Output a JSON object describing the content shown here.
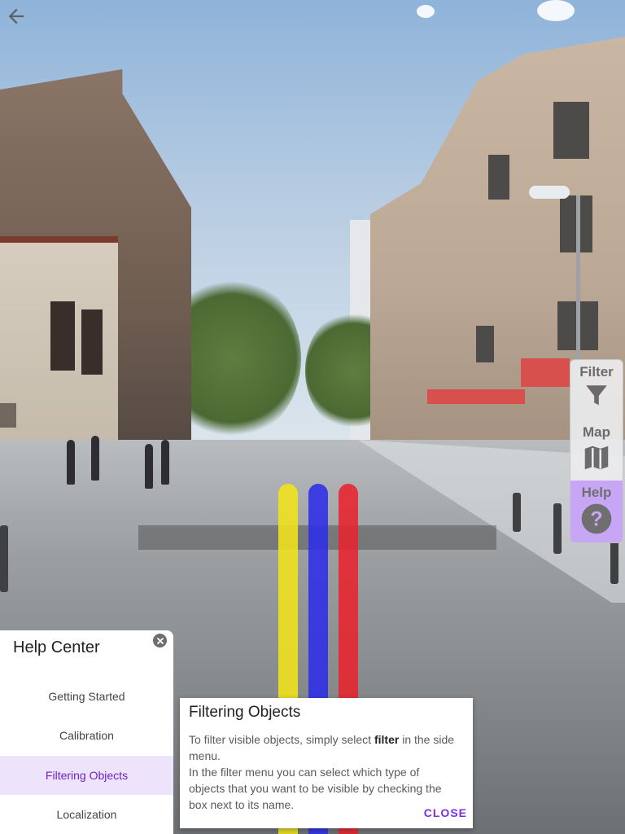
{
  "colors": {
    "accent": "#7b2fe0",
    "selected_bg": "#ede3fb",
    "help_active_bg": "#c6a6f5",
    "path_yellow": "#f2e21a",
    "path_blue": "#2e2ee8",
    "path_red": "#e8232e"
  },
  "nav": {
    "back_icon": "arrow-left-icon"
  },
  "side_menu": {
    "items": [
      {
        "label": "Filter",
        "icon": "filter-icon",
        "active": false
      },
      {
        "label": "Map",
        "icon": "map-icon",
        "active": false
      },
      {
        "label": "Help",
        "icon": "help-icon",
        "active": true
      }
    ]
  },
  "help_center": {
    "title": "Help Center",
    "close_icon": "close-circle-icon",
    "items": [
      {
        "label": "Getting Started",
        "selected": false
      },
      {
        "label": "Calibration",
        "selected": false
      },
      {
        "label": "Filtering Objects",
        "selected": true
      },
      {
        "label": "Localization",
        "selected": false
      }
    ]
  },
  "dialog": {
    "title": "Filtering Objects",
    "body_line1_prefix": "To filter visible objects, simply select ",
    "body_line1_bold": "filter",
    "body_line1_suffix": " in the side menu.",
    "body_line2": "In the filter menu you can select which type of objects that you want to be visible by checking the box next to its name.",
    "close_label": "CLOSE"
  }
}
